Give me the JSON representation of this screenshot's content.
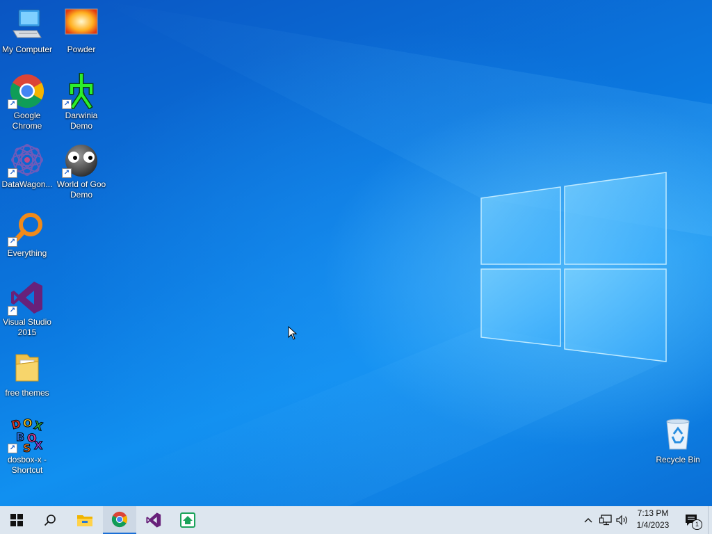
{
  "desktop": {
    "icons": [
      {
        "label": "My Computer"
      },
      {
        "label": "Powder"
      },
      {
        "label": "Google Chrome"
      },
      {
        "label": "Darwinia Demo"
      },
      {
        "label": "DataWagon..."
      },
      {
        "label": "World of Goo Demo"
      },
      {
        "label": "Everything"
      },
      {
        "label": "Visual Studio 2015"
      },
      {
        "label": "free themes"
      },
      {
        "label": "dosbox-x - Shortcut"
      },
      {
        "label": "Recycle Bin"
      }
    ]
  },
  "taskbar": {
    "items": [
      "start-icon",
      "search-icon",
      "file-explorer-icon",
      "chrome-icon",
      "visual-studio-icon",
      "app-icon"
    ],
    "clock": {
      "time": "7:13 PM",
      "date": "1/4/2023"
    },
    "notification_count": "1"
  },
  "colors": {
    "accent": "#1b6fd6",
    "taskbar": "#dde6ef",
    "desktop": "#0a6fd8"
  }
}
